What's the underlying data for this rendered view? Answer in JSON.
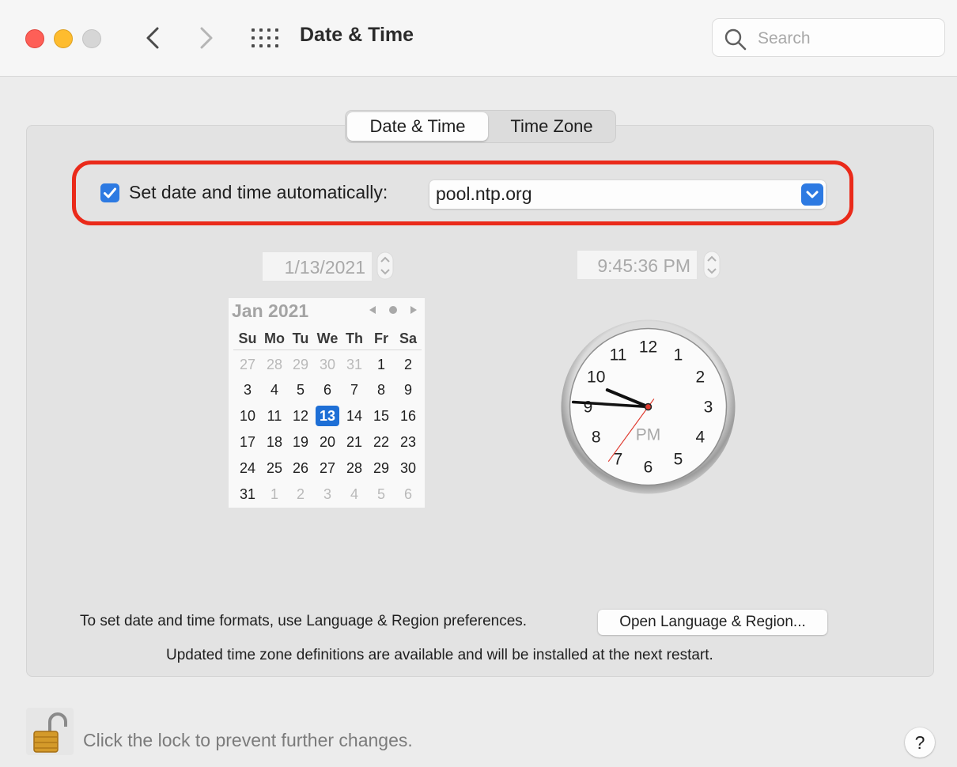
{
  "window": {
    "title": "Date & Time",
    "search_placeholder": "Search",
    "traffic_lights": {
      "close": "#fe5f57",
      "minimize": "#febc2e",
      "zoom": "#d6d6d6"
    },
    "nav": {
      "back_icon": "chevron-left",
      "forward_icon": "chevron-right",
      "grid_icon": "show-all-grid"
    }
  },
  "tabs": [
    {
      "label": "Date & Time",
      "selected": true
    },
    {
      "label": "Time Zone",
      "selected": false
    }
  ],
  "auto_set": {
    "checked": true,
    "label": "Set date and time automatically:",
    "server": "pool.ntp.org",
    "highlight_color": "#ea2a1a"
  },
  "date_field": {
    "value": "1/13/2021"
  },
  "time_field": {
    "value": "9:45:36 PM"
  },
  "calendar": {
    "month_label": "Jan 2021",
    "weekday_headers": [
      "Su",
      "Mo",
      "Tu",
      "We",
      "Th",
      "Fr",
      "Sa"
    ],
    "weeks": [
      [
        "27",
        "28",
        "29",
        "30",
        "31",
        "1",
        "2"
      ],
      [
        "3",
        "4",
        "5",
        "6",
        "7",
        "8",
        "9"
      ],
      [
        "10",
        "11",
        "12",
        "13",
        "14",
        "15",
        "16"
      ],
      [
        "17",
        "18",
        "19",
        "20",
        "21",
        "22",
        "23"
      ],
      [
        "24",
        "25",
        "26",
        "27",
        "28",
        "29",
        "30"
      ],
      [
        "31",
        "1",
        "2",
        "3",
        "4",
        "5",
        "6"
      ]
    ],
    "selected_day": "13",
    "selected_color": "#1e6fd6"
  },
  "clock": {
    "numerals": [
      "12",
      "1",
      "2",
      "3",
      "4",
      "5",
      "6",
      "7",
      "8",
      "9",
      "10",
      "11"
    ],
    "period": "PM",
    "hour": 9,
    "minute": 45,
    "second": 36,
    "second_hand_color": "#e03b30"
  },
  "footer": {
    "formats_text": "To set date and time formats, use Language & Region preferences.",
    "open_button": "Open Language & Region...",
    "updated_text": "Updated time zone definitions are available and will be installed at the next restart.",
    "lock_text": "Click the lock to prevent further changes.",
    "lock_icon": "padlock-open",
    "help_label": "?"
  }
}
